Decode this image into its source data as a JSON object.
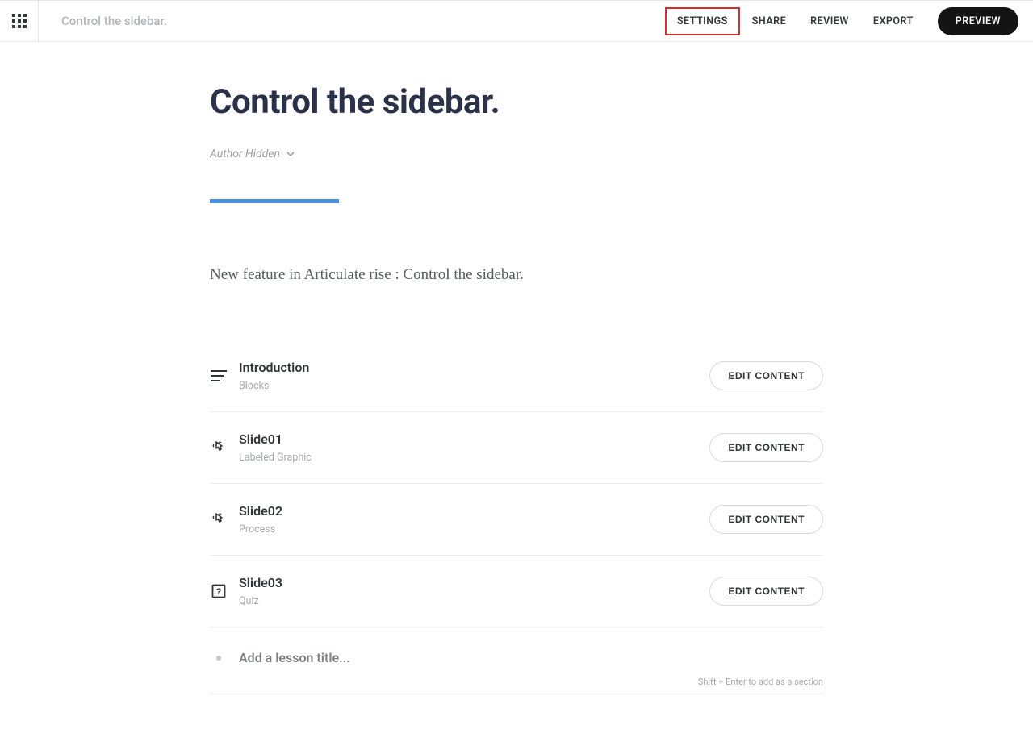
{
  "header": {
    "course_label": "Control the sidebar.",
    "nav": {
      "settings": "SETTINGS",
      "share": "SHARE",
      "review": "REVIEW",
      "export": "EXPORT",
      "preview": "PREVIEW"
    }
  },
  "main": {
    "title": "Control the sidebar.",
    "author_label": "Author Hidden",
    "description": "New feature in Articulate rise : Control the sidebar.",
    "edit_label": "EDIT CONTENT",
    "lessons": [
      {
        "title": "Introduction",
        "type": "Blocks",
        "icon": "lines"
      },
      {
        "title": "Slide01",
        "type": "Labeled Graphic",
        "icon": "interactive"
      },
      {
        "title": "Slide02",
        "type": "Process",
        "icon": "interactive"
      },
      {
        "title": "Slide03",
        "type": "Quiz",
        "icon": "quiz"
      }
    ],
    "add_placeholder": "Add a lesson title...",
    "hint": "Shift + Enter to add as a section"
  }
}
